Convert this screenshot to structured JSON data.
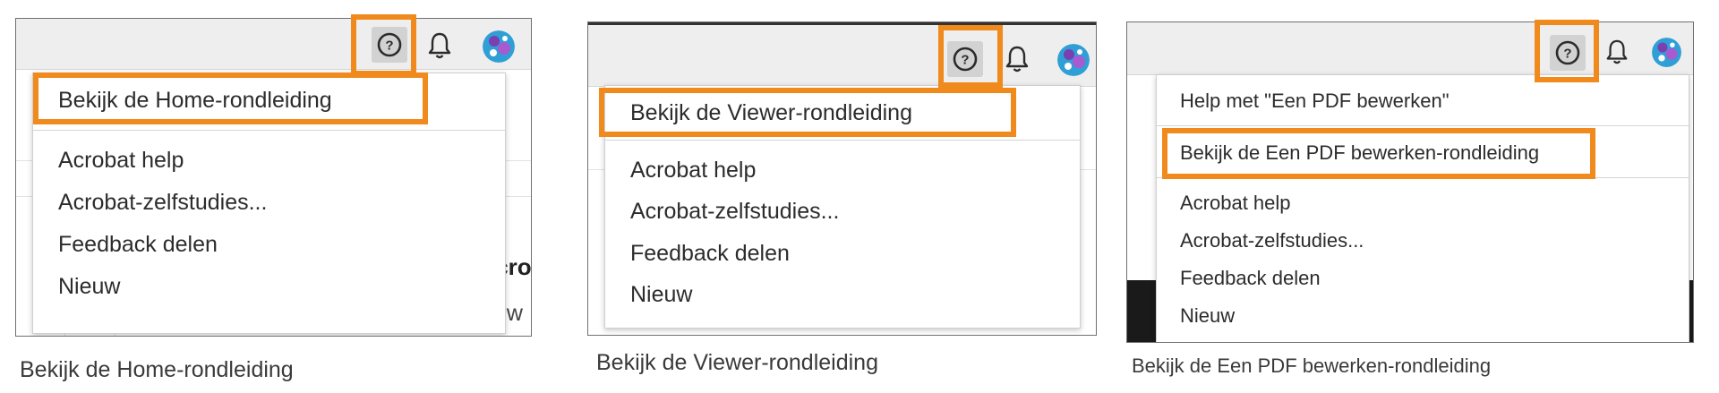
{
  "colors": {
    "highlight": "#f08a1c",
    "toolbar": "#eeeeee",
    "avatar": "#2f9fd6"
  },
  "icons": {
    "help": "help-circle-icon",
    "notifications": "bell-icon",
    "profile": "avatar"
  },
  "panel_home": {
    "menu": [
      "Bekijk de Home-rondleiding",
      "Acrobat help",
      "Acrobat-zelfstudies...",
      "Feedback delen",
      "Nieuw"
    ],
    "background_fragments": [
      ".cro",
      "uw"
    ],
    "caption": "Bekijk de Home-rondleiding"
  },
  "panel_viewer": {
    "menu": [
      "Bekijk de Viewer-rondleiding",
      "Acrobat help",
      "Acrobat-zelfstudies...",
      "Feedback delen",
      "Nieuw"
    ],
    "caption": "Bekijk de Viewer-rondleiding"
  },
  "panel_edit": {
    "menu": [
      "Help met \"Een PDF bewerken\"",
      "Bekijk de Een PDF bewerken-rondleiding",
      "Acrobat help",
      "Acrobat-zelfstudies...",
      "Feedback delen",
      "Nieuw"
    ],
    "caption": "Bekijk de Een PDF bewerken-rondleiding"
  }
}
